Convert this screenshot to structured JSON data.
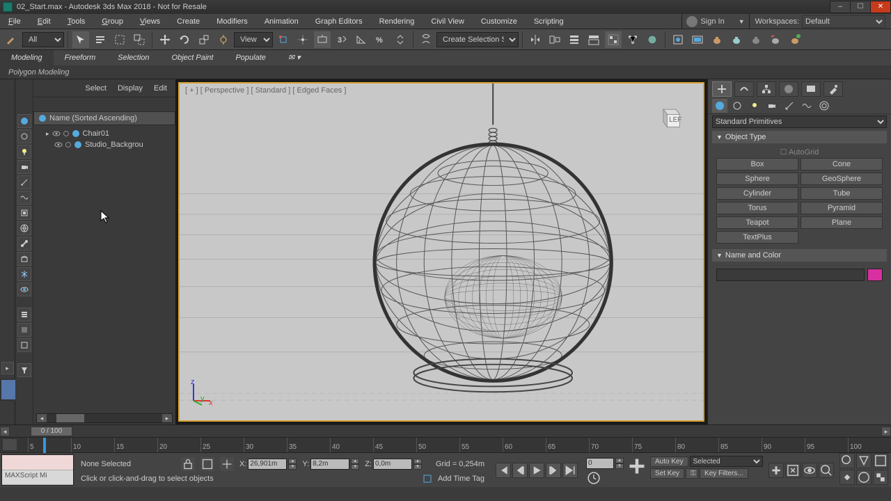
{
  "title": "02_Start.max - Autodesk 3ds Max 2018 - Not for Resale",
  "menus": [
    "File",
    "Edit",
    "Tools",
    "Group",
    "Views",
    "Create",
    "Modifiers",
    "Animation",
    "Graph Editors",
    "Rendering",
    "Civil View",
    "Customize",
    "Scripting"
  ],
  "signin_label": "Sign In",
  "workspace_label": "Workspaces:",
  "workspace_value": "Default",
  "selection_filter": "All",
  "view_dd": "View",
  "named_sel": "Create Selection Se",
  "ribbon_tabs": [
    "Modeling",
    "Freeform",
    "Selection",
    "Object Paint",
    "Populate"
  ],
  "ribbon_sub": "Polygon Modeling",
  "scene_tabs": [
    "Select",
    "Display",
    "Edit"
  ],
  "scene_header": "Name (Sorted Ascending)",
  "scene_items": [
    "Chair01",
    "Studio_Backgrou"
  ],
  "viewport_label": "[ + ]  [ Perspective ]  [ Standard ]  [ Edged Faces ]",
  "viewcube_face": "LEFT",
  "create_dd": "Standard Primitives",
  "roll_objtype": "Object Type",
  "autogrid": "AutoGrid",
  "primitives": [
    "Box",
    "Cone",
    "Sphere",
    "GeoSphere",
    "Cylinder",
    "Tube",
    "Torus",
    "Pyramid",
    "Teapot",
    "Plane",
    "TextPlus"
  ],
  "roll_name": "Name and Color",
  "slider_value": "0 / 100",
  "ticks": [
    "5",
    "10",
    "15",
    "20",
    "25",
    "30",
    "35",
    "40",
    "45",
    "50",
    "55",
    "60",
    "65",
    "70",
    "75",
    "80",
    "85",
    "90",
    "95",
    "100"
  ],
  "status_none": "None Selected",
  "status_hint": "Click or click-and-drag to select objects",
  "maxscript_label": "MAXScript Mi",
  "coord_x_lbl": "X:",
  "coord_x": "26,901m",
  "coord_y_lbl": "Y:",
  "coord_y": "8,2m",
  "coord_z_lbl": "Z:",
  "coord_z": "0,0m",
  "grid_label": "Grid = 0,254m",
  "addtag": "Add Time Tag",
  "autokey": "Auto Key",
  "setkey": "Set Key",
  "sel_dd": "Selected",
  "keyfilters": "Key Filters...",
  "color_swatch": "#d830a0"
}
